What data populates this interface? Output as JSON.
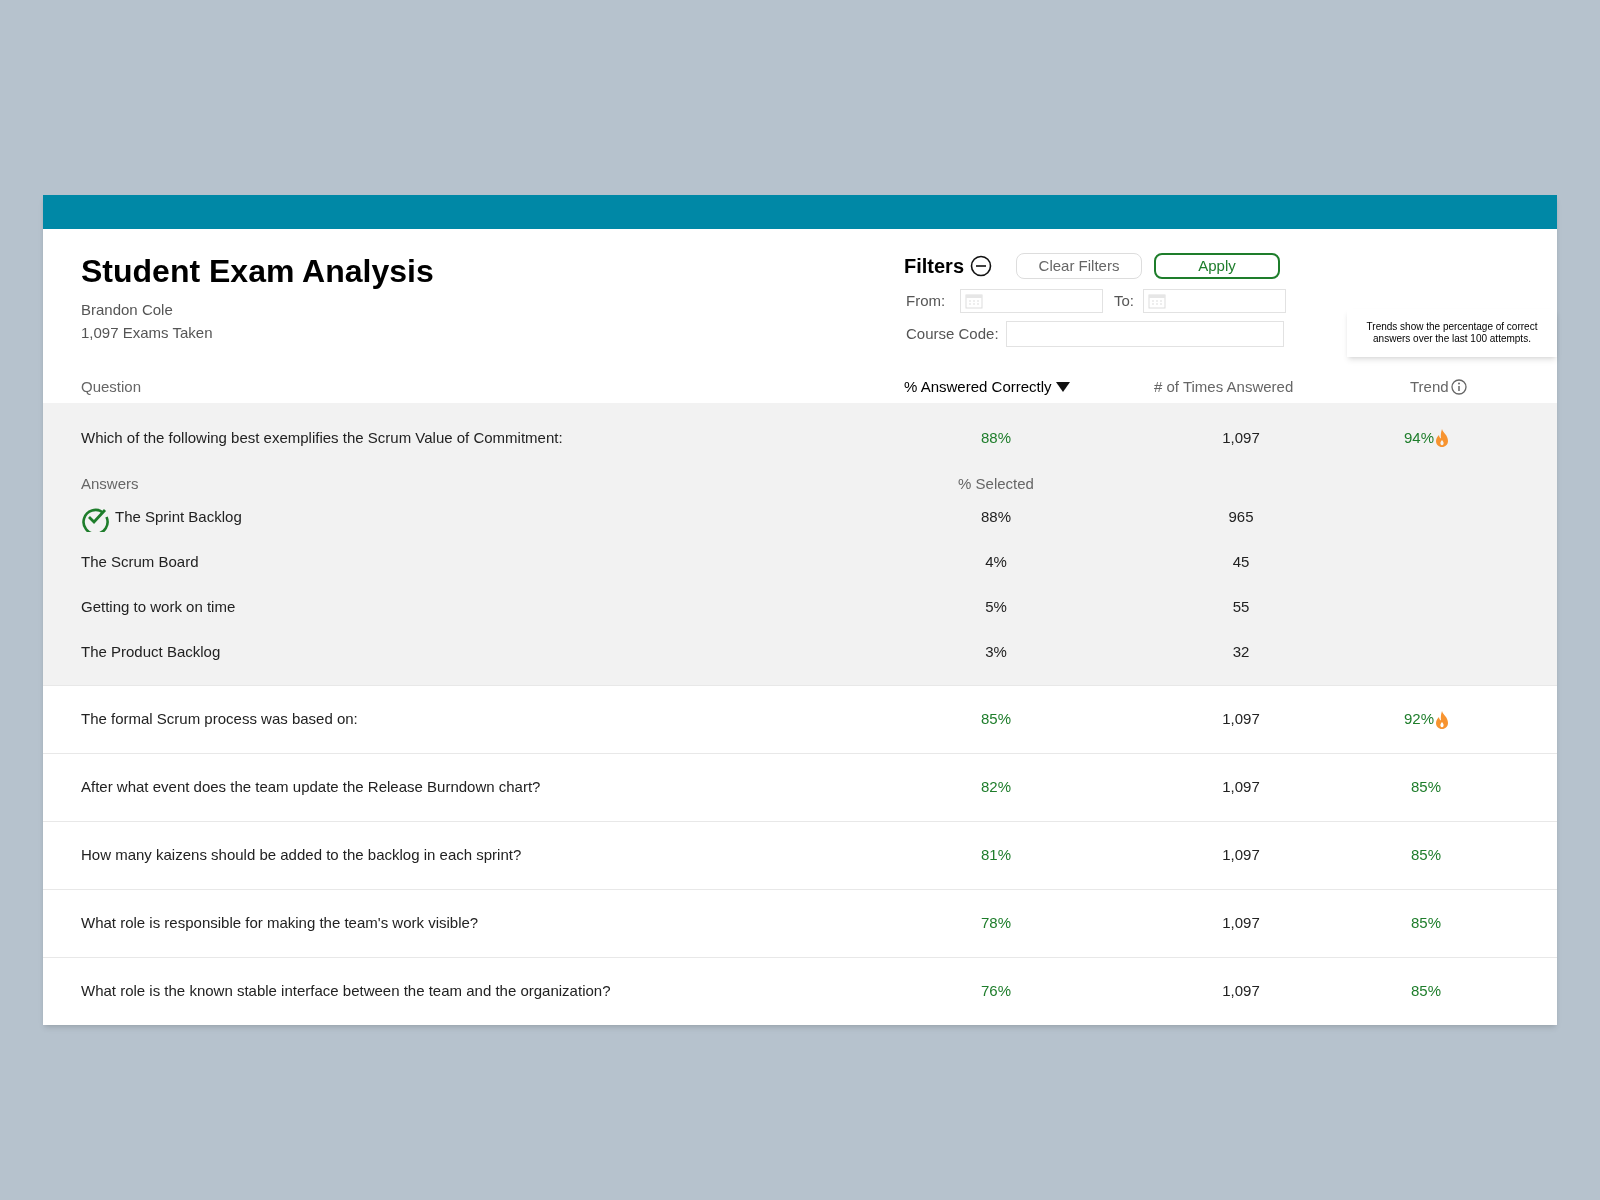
{
  "title": "Student Exam Analysis",
  "student": "Brandon Cole",
  "exams_taken": "1,097 Exams Taken",
  "filters": {
    "label": "Filters",
    "expanded": true,
    "clear_button": "Clear Filters",
    "apply_button": "Apply",
    "from_label": "From:",
    "to_label": "To:",
    "course_code_label": "Course Code:"
  },
  "tooltip": "Trends show the percentage of correct answers over the last 100 attempts.",
  "columns": {
    "question": "Question",
    "correct": "% Answered Correctly",
    "times": "# of Times Answered",
    "trend": "Trend"
  },
  "answers_header": {
    "answers": "Answers",
    "selected": "% Selected"
  },
  "rows": [
    {
      "question": "Which of the following best exemplifies the Scrum Value of Commitment:",
      "correct": "88%",
      "times": "1,097",
      "trend": "94%",
      "hot": true,
      "expanded": true,
      "answers": [
        {
          "text": "The Sprint Backlog",
          "selected_pct": "88%",
          "count": "965",
          "correct": true
        },
        {
          "text": "The Scrum Board",
          "selected_pct": "4%",
          "count": "45",
          "correct": false
        },
        {
          "text": "Getting to work on time",
          "selected_pct": "5%",
          "count": "55",
          "correct": false
        },
        {
          "text": "The Product Backlog",
          "selected_pct": "3%",
          "count": "32",
          "correct": false
        }
      ]
    },
    {
      "question": "The formal Scrum process was based on:",
      "correct": "85%",
      "times": "1,097",
      "trend": "92%",
      "hot": true,
      "expanded": false
    },
    {
      "question": "After what event does the team update the Release Burndown chart?",
      "correct": "82%",
      "times": "1,097",
      "trend": "85%",
      "hot": false,
      "expanded": false
    },
    {
      "question": "How many kaizens should be added to the backlog in each sprint?",
      "correct": "81%",
      "times": "1,097",
      "trend": "85%",
      "hot": false,
      "expanded": false
    },
    {
      "question": "What role is responsible for making the team's work visible?",
      "correct": "78%",
      "times": "1,097",
      "trend": "85%",
      "hot": false,
      "expanded": false
    },
    {
      "question": "What role is the known stable interface between the team and the organization?",
      "correct": "76%",
      "times": "1,097",
      "trend": "85%",
      "hot": false,
      "expanded": false
    }
  ]
}
